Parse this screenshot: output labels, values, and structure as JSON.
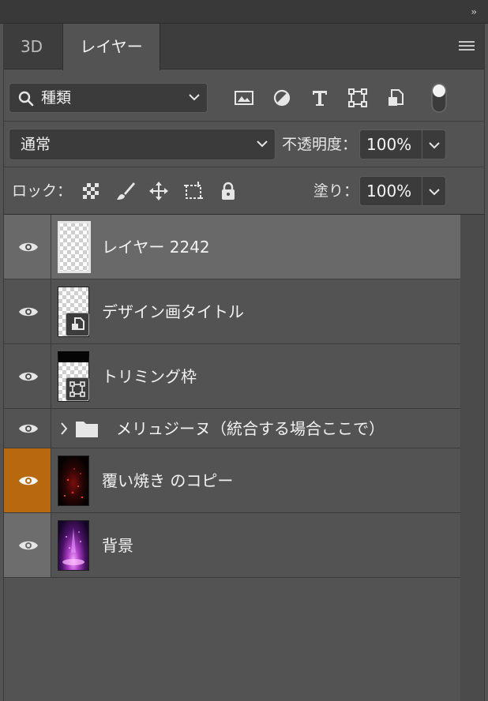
{
  "topbar": {
    "collapse_glyph": "››"
  },
  "tabs": [
    {
      "label": "3D",
      "active": false
    },
    {
      "label": "レイヤー",
      "active": true
    }
  ],
  "filter": {
    "kind_label": "種類",
    "icons": [
      "image-filter-icon",
      "adjustment-filter-icon",
      "type-filter-icon",
      "shape-filter-icon",
      "smart-object-filter-icon",
      "filter-toggle-icon"
    ]
  },
  "blend": {
    "mode": "通常",
    "opacity_label": "不透明度：",
    "opacity_value": "100%"
  },
  "lock": {
    "label": "ロック：",
    "icons": [
      "lock-transparent-pixels-icon",
      "lock-image-pixels-icon",
      "lock-position-icon",
      "lock-artboard-icon",
      "lock-all-icon"
    ],
    "fill_label": "塗り：",
    "fill_value": "100%"
  },
  "layers": [
    {
      "name": "レイヤー 2242",
      "type": "pixel",
      "selected": true,
      "visible": true,
      "eye_bg": "none"
    },
    {
      "name": "デザイン画タイトル",
      "type": "smart-object",
      "selected": false,
      "visible": true,
      "eye_bg": "none"
    },
    {
      "name": "トリミング枠",
      "type": "shape",
      "selected": false,
      "visible": true,
      "eye_bg": "none"
    },
    {
      "name": "メリュジーヌ（統合する場合ここで）",
      "type": "group",
      "selected": false,
      "visible": true,
      "eye_bg": "none"
    },
    {
      "name": "覆い焼き のコピー",
      "type": "pixel",
      "selected": false,
      "visible": true,
      "eye_bg": "#b8690f"
    },
    {
      "name": "背景",
      "type": "pixel",
      "selected": false,
      "visible": true,
      "eye_bg": "#6d6d6d"
    }
  ],
  "colors": {
    "panel_bg": "#535353",
    "selected_row": "#696969",
    "orange_label": "#b8690f",
    "gray_label": "#6d6d6d"
  }
}
